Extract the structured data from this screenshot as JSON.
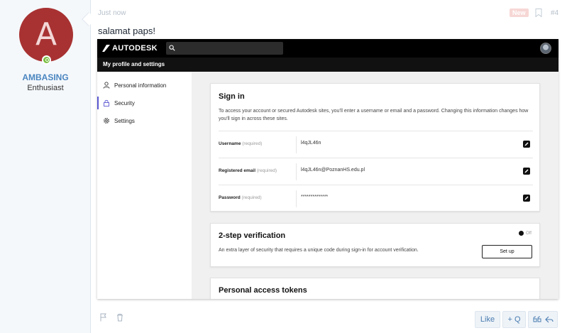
{
  "user": {
    "avatar_letter": "A",
    "avatar_color": "#a83232",
    "name": "AMBASING",
    "title": "Enthusiast"
  },
  "post": {
    "time": "Just now",
    "badge": "New",
    "number": "#4",
    "message": "salamat paps!"
  },
  "screenshot": {
    "brand": "AUTODESK",
    "subheader": "My profile and settings",
    "nav": [
      {
        "label": "Personal information",
        "icon": "person-icon"
      },
      {
        "label": "Security",
        "icon": "lock-icon"
      },
      {
        "label": "Settings",
        "icon": "gear-icon"
      }
    ],
    "signin": {
      "title": "Sign in",
      "description": "To access your account or secured Autodesk sites, you'll enter a username or email and a password. Changing this information changes how you'll sign in across these sites.",
      "rows": [
        {
          "label": "Username",
          "req": "(required)",
          "value": "l4qJL46n"
        },
        {
          "label": "Registered email",
          "req": "(required)",
          "value": "l4qJL46n@PoznanHS.edu.pl"
        },
        {
          "label": "Password",
          "req": "(required)",
          "value": "**************"
        }
      ]
    },
    "two_step": {
      "title": "2-step verification",
      "status": "Off",
      "description": "An extra layer of security that requires a unique code during sign-in for account verification.",
      "button": "Set up"
    },
    "tokens": {
      "title": "Personal access tokens"
    }
  },
  "actions": {
    "like": "Like",
    "quote": "+ Q"
  },
  "colors": {
    "accent": "#4a86c0",
    "online": "#7bc043",
    "new_badge": "#f6d7d5"
  }
}
